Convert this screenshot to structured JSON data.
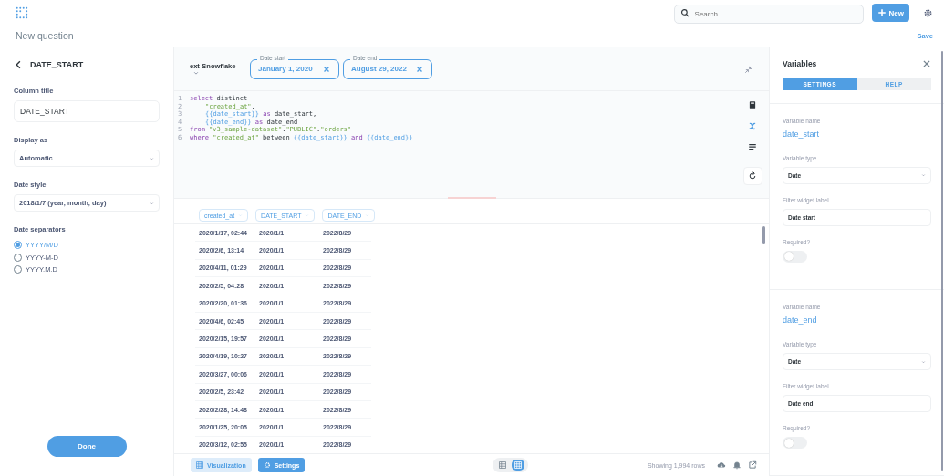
{
  "header": {
    "title": "New question",
    "search": {
      "placeholder": "Search…"
    },
    "new_button": "New",
    "save": "Save"
  },
  "column_settings": {
    "back_title": "DATE_START",
    "column_title": {
      "label": "Column title",
      "value": "DATE_START"
    },
    "display_as": {
      "label": "Display as",
      "value": "Automatic"
    },
    "date_style": {
      "label": "Date style",
      "value": "2018/1/7 (year, month, day)"
    },
    "date_separators": {
      "label": "Date separators",
      "options": [
        {
          "label": "YYYY/M/D",
          "selected": true
        },
        {
          "label": "YYYY-M-D",
          "selected": false
        },
        {
          "label": "YYYY.M.D",
          "selected": false
        }
      ]
    },
    "done_button": "Done"
  },
  "query": {
    "database": "ext-Snowflake",
    "filters": [
      {
        "label": "Date start",
        "value": "January 1, 2020"
      },
      {
        "label": "Date end",
        "value": "August 29, 2022"
      }
    ],
    "lines": [
      {
        "number": "1",
        "indent": false,
        "tokens": [
          {
            "kind": "keyword",
            "text": "select"
          },
          {
            "kind": "plain",
            "text": " distinct"
          }
        ]
      },
      {
        "number": "2",
        "indent": true,
        "tokens": [
          {
            "kind": "string",
            "text": "\"created_at\""
          },
          {
            "kind": "plain",
            "text": ","
          }
        ]
      },
      {
        "number": "3",
        "indent": true,
        "tokens": [
          {
            "kind": "variable",
            "text": "{{date_start}}"
          },
          {
            "kind": "keyword",
            "text": " as"
          },
          {
            "kind": "plain",
            "text": " date_start,"
          }
        ]
      },
      {
        "number": "4",
        "indent": true,
        "tokens": [
          {
            "kind": "variable",
            "text": "{{date_end}}"
          },
          {
            "kind": "keyword",
            "text": " as"
          },
          {
            "kind": "plain",
            "text": " date_end"
          }
        ]
      },
      {
        "number": "5",
        "indent": false,
        "tokens": [
          {
            "kind": "keyword",
            "text": "from"
          },
          {
            "kind": "string",
            "text": " \"v3_sample-dataset\""
          },
          {
            "kind": "plain",
            "text": "."
          },
          {
            "kind": "string",
            "text": "\"PUBLIC\""
          },
          {
            "kind": "plain",
            "text": "."
          },
          {
            "kind": "string",
            "text": "\"orders\""
          }
        ]
      },
      {
        "number": "6",
        "indent": false,
        "tokens": [
          {
            "kind": "keyword",
            "text": "where"
          },
          {
            "kind": "string",
            "text": " \"created_at\""
          },
          {
            "kind": "plain",
            "text": " between "
          },
          {
            "kind": "variable",
            "text": "{{date_start}}"
          },
          {
            "kind": "keyword",
            "text": " and"
          },
          {
            "kind": "variable",
            "text": " {{date_end}}"
          }
        ]
      }
    ]
  },
  "table": {
    "columns": [
      "created_at",
      "DATE_START",
      "DATE_END"
    ],
    "rows": [
      [
        "2020/1/17, 02:44",
        "2020/1/1",
        "2022/8/29"
      ],
      [
        "2020/2/6, 13:14",
        "2020/1/1",
        "2022/8/29"
      ],
      [
        "2020/4/11, 01:29",
        "2020/1/1",
        "2022/8/29"
      ],
      [
        "2020/2/5, 04:28",
        "2020/1/1",
        "2022/8/29"
      ],
      [
        "2020/2/20, 01:36",
        "2020/1/1",
        "2022/8/29"
      ],
      [
        "2020/4/6, 02:45",
        "2020/1/1",
        "2022/8/29"
      ],
      [
        "2020/2/15, 19:57",
        "2020/1/1",
        "2022/8/29"
      ],
      [
        "2020/4/19, 10:27",
        "2020/1/1",
        "2022/8/29"
      ],
      [
        "2020/3/27, 00:06",
        "2020/1/1",
        "2022/8/29"
      ],
      [
        "2020/2/5, 23:42",
        "2020/1/1",
        "2022/8/29"
      ],
      [
        "2020/2/28, 14:48",
        "2020/1/1",
        "2022/8/29"
      ],
      [
        "2020/1/25, 20:05",
        "2020/1/1",
        "2022/8/29"
      ],
      [
        "2020/3/12, 02:55",
        "2020/1/1",
        "2022/8/29"
      ]
    ]
  },
  "footer": {
    "buttons": [
      {
        "label": "Visualization",
        "kind": "light"
      },
      {
        "label": "Settings",
        "kind": "filled"
      }
    ],
    "views": [
      {
        "kind": "table",
        "selected": false
      },
      {
        "kind": "grid",
        "selected": true
      }
    ],
    "row_count": "Showing 1,994 rows"
  },
  "variables": {
    "title": "Variables",
    "tabs": [
      {
        "label": "SETTINGS",
        "selected": true
      },
      {
        "label": "HELP",
        "selected": false
      }
    ],
    "items": [
      {
        "name_label": "Variable name",
        "name": "date_start",
        "type_label": "Variable type",
        "type": "Date",
        "widget_label_label": "Filter widget label",
        "widget_label": "Date start",
        "required_label": "Required?",
        "required": false
      },
      {
        "name_label": "Variable name",
        "name": "date_end",
        "type_label": "Variable type",
        "type": "Date",
        "widget_label_label": "Filter widget label",
        "widget_label": "Date end",
        "required_label": "Required?",
        "required": false
      }
    ]
  }
}
